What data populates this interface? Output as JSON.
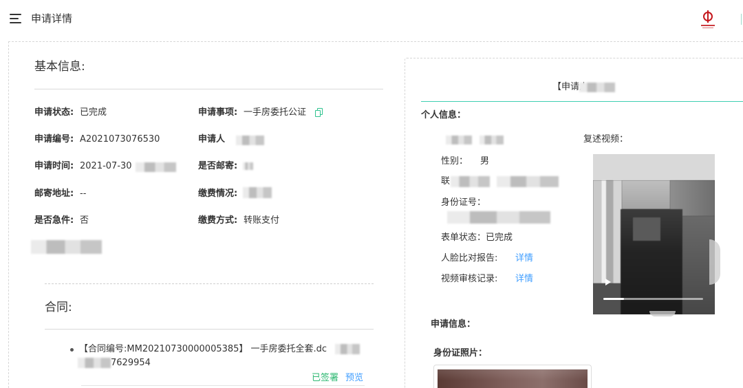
{
  "header": {
    "title": "申请详情"
  },
  "basic_info": {
    "heading": "基本信息:",
    "status": {
      "label": "申请状态:",
      "value": "已完成"
    },
    "matter": {
      "label": "申请事项:",
      "value": "一手房委托公证"
    },
    "number": {
      "label": "申请编号:",
      "value": "A2021073076530"
    },
    "applicant": {
      "label": "申请人"
    },
    "time": {
      "label": "申请时间:",
      "value": "2021-07-30"
    },
    "mailing": {
      "label": "是否邮寄:"
    },
    "address": {
      "label": "邮寄地址:",
      "value": "--"
    },
    "payment_status": {
      "label": "缴费情况:"
    },
    "urgent": {
      "label": "是否急件:",
      "value": "否"
    },
    "payment_method": {
      "label": "缴费方式:",
      "value": "转账支付"
    }
  },
  "contract": {
    "heading": "合同:",
    "items": [
      {
        "name_line1": "【合同编号:MM20210730000005385】 一手房委托全套.dc",
        "name_line2": "7629954",
        "status": "已签署",
        "preview": "预览"
      }
    ]
  },
  "applicant_panel": {
    "title": "【申请人",
    "personal_heading": "个人信息：",
    "gender_label": "性别：",
    "gender_value": "男",
    "contact_label": "联",
    "id_number_label": "身份证号：",
    "form_status_label": "表单状态：",
    "form_status_value": "已完成",
    "face_report_label": "人脸比对报告:",
    "face_report_link": "详情",
    "video_review_label": "视频审核记录:",
    "video_review_link": "详情",
    "video_label": "复述视频：",
    "application_heading": "申请信息：",
    "id_photo_heading": "身份证照片："
  },
  "colors": {
    "text": "#333333",
    "link_blue": "#409eff",
    "signed_green": "#2eb872",
    "copy_icon_green": "#2ec28e",
    "divider_teal": "#3dcfb1",
    "seal_red": "#c4161c",
    "border": "#d6d6d6"
  },
  "icons": {
    "menu": "menu-icon",
    "copy": "copy-icon",
    "play": "play-icon",
    "logo": "seal-logo-icon"
  }
}
